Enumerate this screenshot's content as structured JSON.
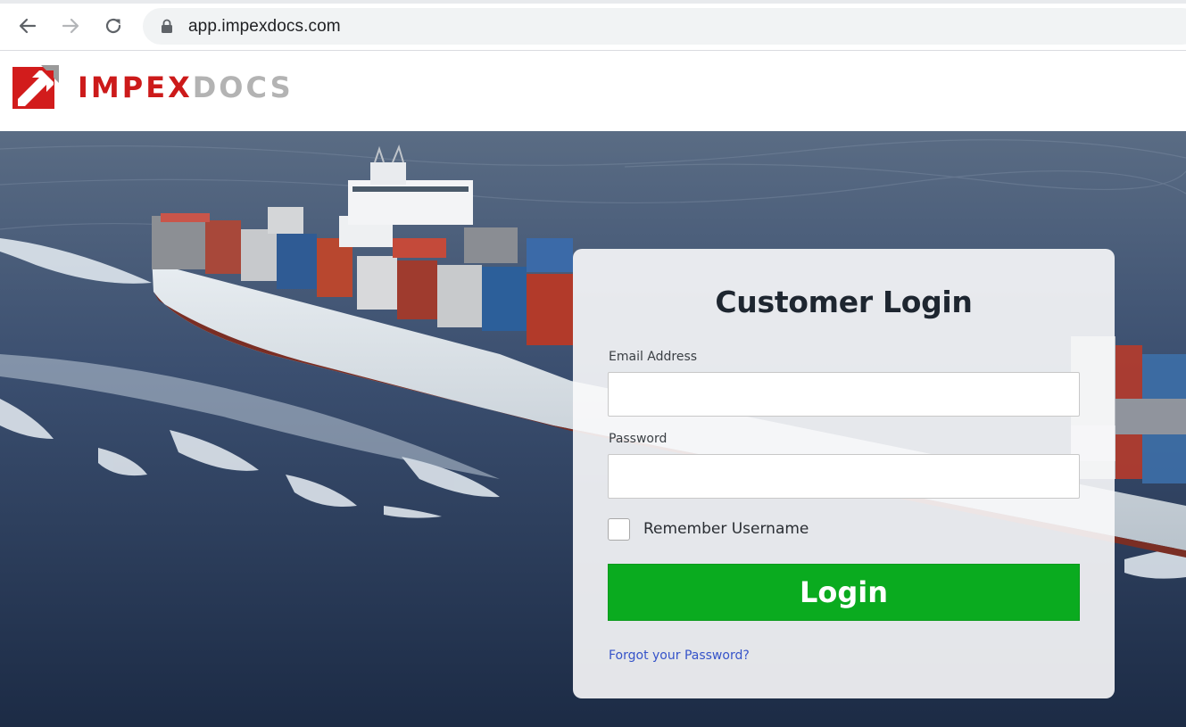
{
  "browser": {
    "url": "app.impexdocs.com",
    "icons": {
      "back": "arrow-left-icon",
      "forward": "arrow-right-icon",
      "reload": "reload-icon",
      "secure": "lock-icon"
    }
  },
  "header": {
    "logo_text_primary": "IMPEX",
    "logo_text_secondary": "DOCS",
    "brand_colors": {
      "primary": "#cc1a1a",
      "secondary": "#b3b3b3"
    }
  },
  "login": {
    "title": "Customer Login",
    "email_label": "Email Address",
    "email_value": "",
    "password_label": "Password",
    "password_value": "",
    "remember_label": "Remember Username",
    "remember_checked": false,
    "button_label": "Login",
    "forgot_link": "Forgot your Password?",
    "colors": {
      "button": "#0aab1f",
      "link": "#3553c9"
    }
  }
}
